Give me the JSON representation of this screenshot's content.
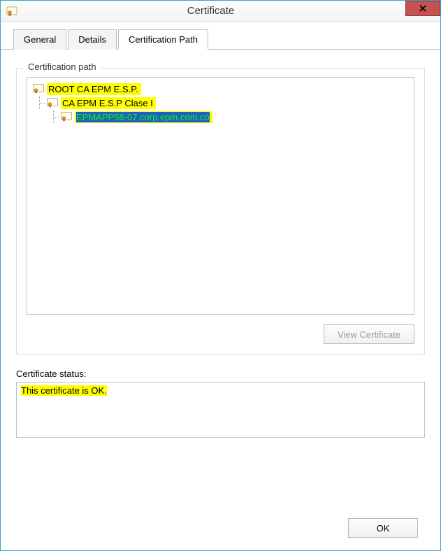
{
  "window": {
    "title": "Certificate"
  },
  "tabs": {
    "general": "General",
    "details": "Details",
    "cert_path": "Certification Path"
  },
  "group": {
    "cert_path_label": "Certification path"
  },
  "tree": {
    "root": "ROOT CA EPM E.S.P.",
    "intermediate": "CA EPM E.S.P Clase I",
    "leaf": "EPMAPP58-07.corp.epm.com.co"
  },
  "buttons": {
    "view_cert": "View Certificate",
    "ok": "OK"
  },
  "status": {
    "label": "Certificate status:",
    "text": "This certificate is OK."
  }
}
